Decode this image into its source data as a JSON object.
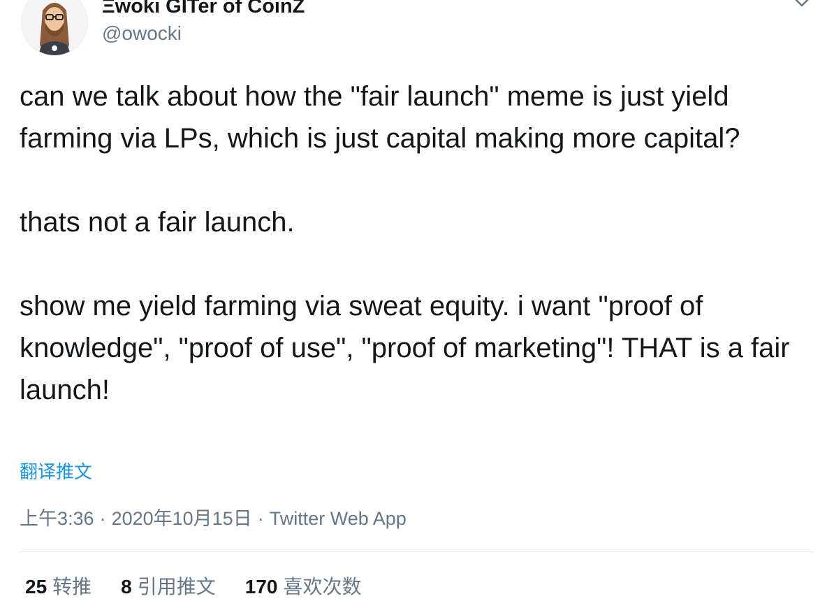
{
  "author": {
    "display_name": "Ξwoki GITer of CoinZ",
    "handle": "@owocki",
    "avatar_icon": "cartoon-avatar"
  },
  "tweet": {
    "paragraphs": [
      "can we talk about how the \"fair launch\" meme is just yield farming via LPs, which is just capital making more capital?",
      "thats not a fair launch.",
      "show me yield farming via sweat equity.  i want \"proof of knowledge\", \"proof of use\", \"proof of marketing\"! THAT is a fair launch!"
    ],
    "translate_label": "翻译推文",
    "time": "上午3:36",
    "date": "2020年10月15日",
    "separator": "·",
    "source": "Twitter Web App"
  },
  "stats": {
    "retweets": {
      "count": "25",
      "label": "转推"
    },
    "quotes": {
      "count": "8",
      "label": "引用推文"
    },
    "likes": {
      "count": "170",
      "label": "喜欢次数"
    }
  },
  "colors": {
    "link": "#1b95e0",
    "secondary_text": "#657786",
    "primary_text": "#14171a",
    "divider": "#e6ecf0"
  }
}
